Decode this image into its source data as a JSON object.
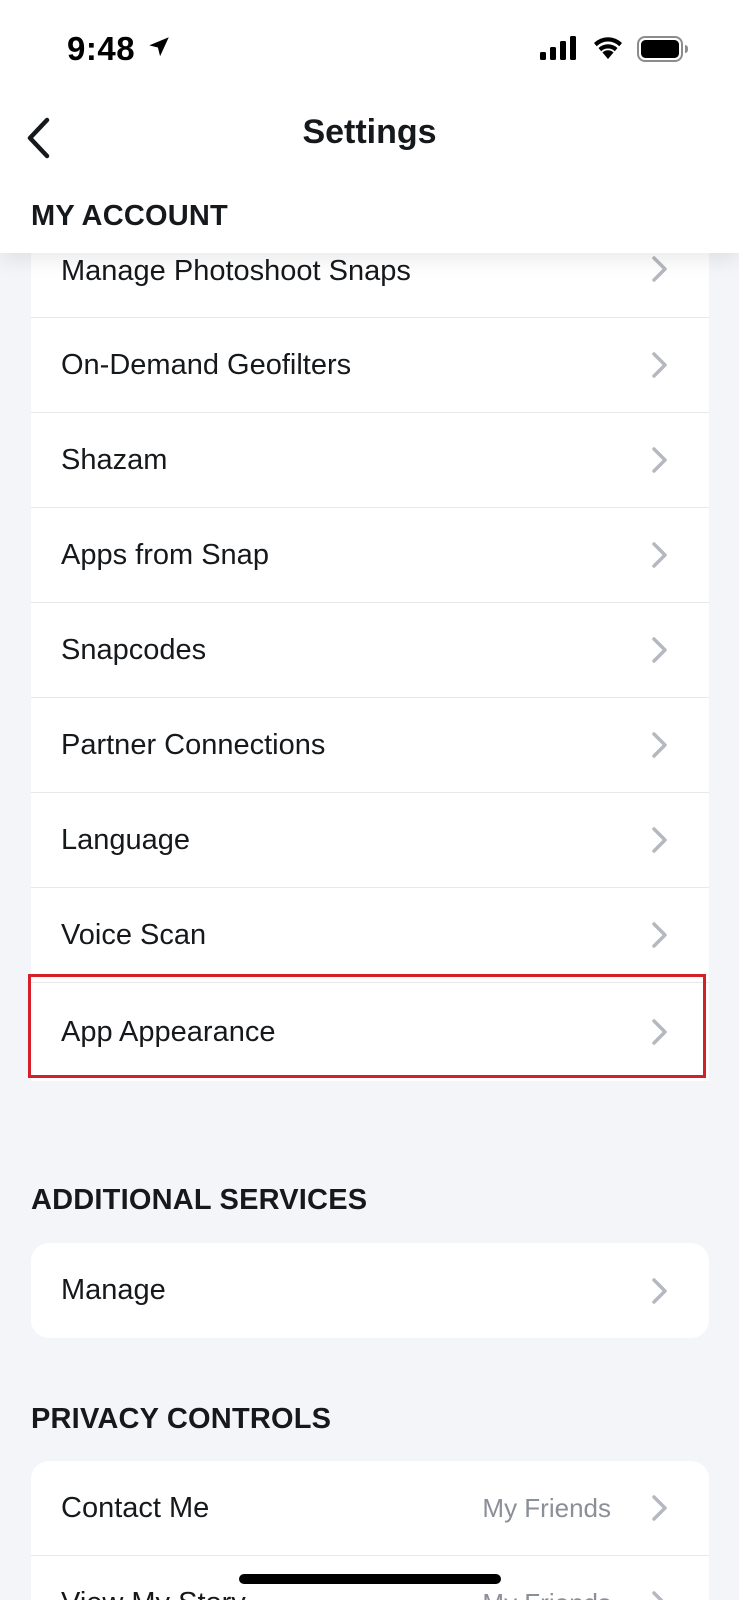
{
  "status_bar": {
    "time": "9:48",
    "icons": [
      "location-arrow-icon",
      "cellular-signal-icon",
      "wifi-icon",
      "battery-icon"
    ]
  },
  "nav": {
    "title": "Settings",
    "back_icon": "chevron-left-icon"
  },
  "my_account": {
    "header": "MY ACCOUNT",
    "items": [
      {
        "label": "Manage Photoshoot Snaps"
      },
      {
        "label": "On-Demand Geofilters"
      },
      {
        "label": "Shazam"
      },
      {
        "label": "Apps from Snap"
      },
      {
        "label": "Snapcodes"
      },
      {
        "label": "Partner Connections"
      },
      {
        "label": "Language"
      },
      {
        "label": "Voice Scan"
      },
      {
        "label": "App Appearance",
        "highlighted": true
      }
    ]
  },
  "additional_services": {
    "header": "ADDITIONAL SERVICES",
    "items": [
      {
        "label": "Manage"
      }
    ]
  },
  "privacy_controls": {
    "header": "PRIVACY CONTROLS",
    "items": [
      {
        "label": "Contact Me",
        "value": "My Friends"
      },
      {
        "label": "View My Story",
        "value": "My Friends"
      }
    ]
  },
  "colors": {
    "background": "#F4F5F8",
    "card": "#FFFFFF",
    "text": "#16191C",
    "secondary_text": "#8A8F98",
    "chevron": "#B5B9BF",
    "highlight": "#D51F2A"
  }
}
